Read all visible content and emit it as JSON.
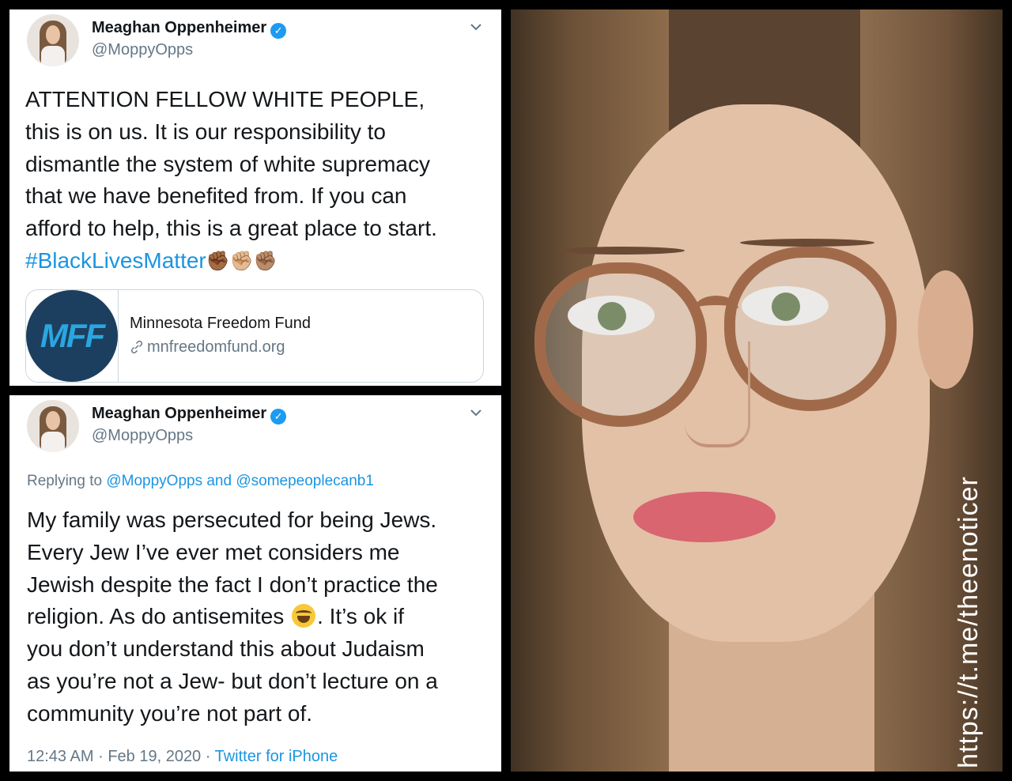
{
  "tweet1": {
    "name": "Meaghan Oppenheimer",
    "handle": "@MoppyOpps",
    "text": "ATTENTION FELLOW WHITE PEOPLE,\nthis is on us. It is our responsibility to\ndismantle the system of white supremacy\nthat we have benefited from. If you can\nafford to help, this is a great place to start.",
    "hashtag": "#BlackLivesMatter",
    "emoji": "✊🏾✊🏼✊🏽",
    "card": {
      "logo_text": "MFF",
      "title": "Minnesota Freedom Fund",
      "url": "mnfreedomfund.org"
    }
  },
  "tweet2": {
    "name": "Meaghan Oppenheimer",
    "handle": "@MoppyOpps",
    "replying_prefix": "Replying to",
    "mention1": "@MoppyOpps",
    "replying_and": "and",
    "mention2": "@somepeoplecanb1",
    "text_before_emoji": "My family was persecuted for being Jews.\nEvery Jew I’ve ever met considers me\nJewish despite the fact I don’t practice the\nreligion. As do antisemites ",
    "text_after_emoji": ". It’s ok if\nyou don’t understand this about Judaism\nas you’re not a Jew- but don’t lecture on a\ncommunity you’re not part of.",
    "time": "12:43 AM",
    "dot1": "·",
    "date": "Feb 19, 2020",
    "dot2": "·",
    "source": "Twitter for iPhone"
  },
  "photo": {
    "watermark": "https://t.me/theenoticer"
  },
  "icons": {
    "verified": "verified-badge-icon",
    "chevron": "chevron-down-icon",
    "link": "link-icon"
  },
  "colors": {
    "link_blue": "#1b95e0",
    "verified_blue": "#1d9bf0",
    "muted_gray": "#657786"
  }
}
